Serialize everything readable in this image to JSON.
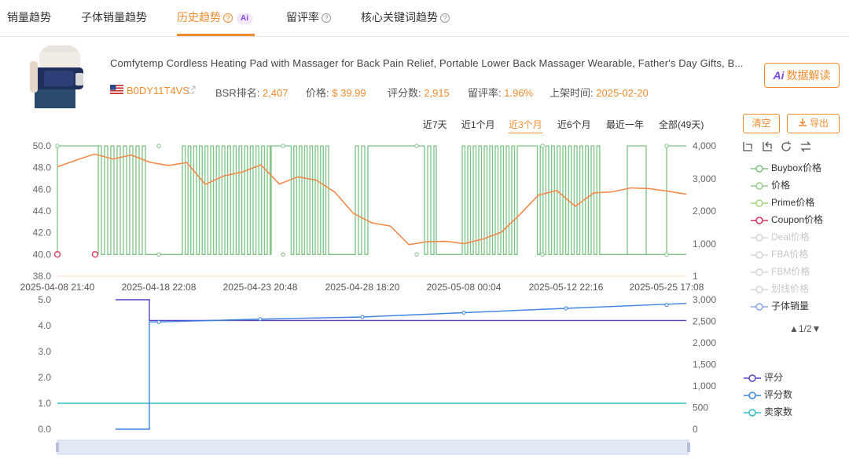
{
  "tabs": [
    {
      "label": "销量趋势",
      "help": false
    },
    {
      "label": "子体销量趋势",
      "help": false
    },
    {
      "label": "历史趋势",
      "help": true,
      "active": true,
      "ai": "Ai"
    },
    {
      "label": "留评率",
      "help": true
    },
    {
      "label": "核心关键词趋势",
      "help": true
    }
  ],
  "product": {
    "title": "Comfytemp Cordless Heating Pad with Massager for Back Pain Relief, Portable Lower Back Massager Wearable, Father's Day Gifts, B...",
    "asin": "B0DY11T4VS",
    "bsr_label": "BSR排名:",
    "bsr_value": "2,407",
    "price_label": "价格:",
    "price_value": "$ 39.99",
    "ratings_label": "评分数:",
    "ratings_value": "2,915",
    "review_rate_label": "留评率:",
    "review_rate_value": "1.96%",
    "launch_label": "上架时间:",
    "launch_value": "2025-02-20",
    "ai_button": "数据解读",
    "ai_prefix": "Ai"
  },
  "ranges": [
    "近7天",
    "近1个月",
    "近3个月",
    "近6个月",
    "最近一年",
    "全部(49天)"
  ],
  "active_range": "近3个月",
  "buttons": {
    "clear": "清空",
    "export": "导出"
  },
  "legend_top": [
    {
      "label": "Buybox价格",
      "color": "#7dc383",
      "enabled": true
    },
    {
      "label": "价格",
      "color": "#8fce86",
      "enabled": true
    },
    {
      "label": "Prime价格",
      "color": "#a3d87a",
      "enabled": true
    },
    {
      "label": "Coupon价格",
      "color": "#d9325a",
      "enabled": true
    },
    {
      "label": "Deal价格",
      "color": "#cccccc",
      "enabled": false
    },
    {
      "label": "FBA价格",
      "color": "#cccccc",
      "enabled": false
    },
    {
      "label": "FBM价格",
      "color": "#cccccc",
      "enabled": false
    },
    {
      "label": "划线价格",
      "color": "#cccccc",
      "enabled": false
    },
    {
      "label": "子体销量",
      "color": "#8fa4f0",
      "enabled": true
    }
  ],
  "pager": "▲1/2▼",
  "legend_bottom": [
    {
      "label": "评分",
      "color": "#5b3fc9"
    },
    {
      "label": "评分数",
      "color": "#3b82e0"
    },
    {
      "label": "卖家数",
      "color": "#2fbfc9"
    }
  ],
  "chart_data": [
    {
      "type": "line",
      "title": "",
      "x_labels": [
        "2025-04-08 21:40",
        "2025-04-18 22:08",
        "2025-04-23 20:48",
        "2025-04-28 18:20",
        "2025-05-08 00:04",
        "2025-05-12 22:16",
        "2025-05-25 17:08"
      ],
      "y_left_ticks": [
        "50.0",
        "48.0",
        "46.0",
        "44.0",
        "42.0",
        "40.0",
        "38.0"
      ],
      "y_left_range": [
        38,
        50
      ],
      "y_right_ticks": [
        "4,000",
        "3,000",
        "2,000",
        "1,000",
        "1"
      ],
      "series": [
        {
          "name": "价格",
          "color": "#7dc383",
          "pattern": "alternating 50.0 / 40.0 price toggling",
          "values_range": [
            40.0,
            50.0
          ]
        },
        {
          "name": "BSR排名",
          "color": "#f5894a",
          "values": [
            3360,
            3560,
            3750,
            3600,
            3720,
            3500,
            3400,
            3490,
            2820,
            3080,
            3200,
            3420,
            2830,
            3050,
            2950,
            2580,
            1930,
            1640,
            1540,
            970,
            1060,
            1070,
            1000,
            1140,
            1350,
            1890,
            2490,
            2630,
            2150,
            2560,
            2590,
            2710,
            2690,
            2610,
            2520
          ]
        },
        {
          "name": "Coupon价格",
          "color": "#d9325a",
          "values": [
            40.0,
            40.0
          ]
        }
      ]
    },
    {
      "type": "line",
      "y_left_ticks": [
        "5.0",
        "4.0",
        "3.0",
        "2.0",
        "1.0",
        "0.0"
      ],
      "y_left_range": [
        0,
        5
      ],
      "y_right_ticks": [
        "3,000",
        "2,500",
        "2,000",
        "1,500",
        "1,000",
        "500",
        "0"
      ],
      "series": [
        {
          "name": "评分",
          "color": "#5b3fc9",
          "values": [
            5.0,
            4.2
          ]
        },
        {
          "name": "评分数",
          "color": "#3b82e0",
          "values": [
            0,
            2485,
            2550,
            2600,
            2700,
            2800,
            2915
          ]
        },
        {
          "name": "卖家数",
          "color": "#2fbfc9",
          "values": [
            1.0,
            1.0
          ]
        }
      ]
    }
  ]
}
